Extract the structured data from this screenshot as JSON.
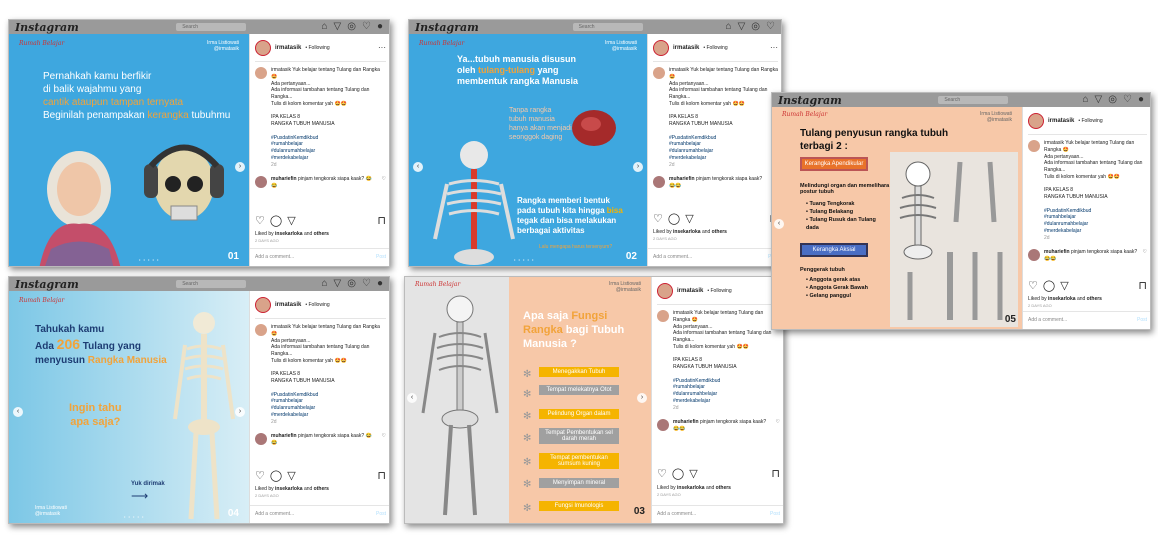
{
  "app": {
    "logo": "Instagram",
    "search": "Search"
  },
  "common": {
    "user": "irmatasik",
    "following": "• Following",
    "caption_lines": [
      "irmatasik Yuk belajar tentang Tulang dan Rangka 🤩",
      "Ada pertanyaan...",
      "Ada informasi tambahan tentang Tulang dan Rangka...",
      "Tulis di kolom komentar yah 🤩🤩"
    ],
    "class_lines": [
      "IPA KELAS 8",
      "RANGKA TUBUH MANUSIA"
    ],
    "hashtags": [
      "#PusdatinKemdikbud",
      "#rumahbelajar",
      "#dulanrumahbelajar",
      "#merdekabelajar"
    ],
    "days": "2d",
    "comment_user": "muhariefin",
    "comment_text": "pinjam tengkorak siapa kaak? 😂😂",
    "liked_pre": "Liked by",
    "liked_user": "insekarloka",
    "liked_and": "and",
    "liked_others": "others",
    "time": "2 DAYS AGO",
    "add_comment": "Add a comment...",
    "post_btn": "Post",
    "brand": "Rumah Belajar",
    "credit": "Irma Listiowati @irmatasik"
  },
  "slides": {
    "s1": {
      "l1": "Pernahkah kamu berfikir",
      "l2": "di balik wajahmu yang",
      "l3": "cantik ataupun tampan ternyata",
      "l4a": "Beginilah penampakan ",
      "l4b": "kerangka",
      "l4c": " tubuhmu",
      "num": "01"
    },
    "s2": {
      "l1a": "Ya...",
      "l1b": "tubuh manusia disusun",
      "l2a": "oleh ",
      "l2b": "tulang-tulang",
      "l2c": " yang",
      "l3": "membentuk rangka Manusia",
      "side": [
        "Tanpa rangka",
        "tubuh manusia",
        "hanya akan menjadi",
        "seonggok daging"
      ],
      "b1": "Rangka memberi bentuk",
      "b2a": "pada tubuh kita hingga ",
      "b2b": "bisa",
      "b3": "tegak dan bisa melakukan",
      "b4": "berbagai aktivitas",
      "foot": "Lalu mengapa harus tersenyum?",
      "num": "02"
    },
    "s3": {
      "l1": "Tahukah kamu",
      "l2a": "Ada ",
      "l2b": "206",
      "l2c": " Tulang yang",
      "l3a": "menyusun ",
      "l3b": "Rangka Manusia",
      "q1": "Ingin tahu",
      "q2": "apa saja?",
      "hint": "Yuk dirimak",
      "num": "04"
    },
    "s4": {
      "t1a": "Apa saja ",
      "t1b": "Fungsi",
      "t2a": "Rangka ",
      "t2b": "bagi Tubuh",
      "t3": "Manusia",
      "t4": "?",
      "items": [
        "Menegakkan Tubuh",
        "Tempat melekatnya Otot",
        "Pelindung Organ dalam",
        "Tempat Pembentukan sel darah merah",
        "Tempat pembentukan sumsum kuning",
        "Menyimpan mineral",
        "Fungsi Imunologis"
      ],
      "num": "03"
    },
    "s5": {
      "t1": "Tulang penyusun rangka tubuh",
      "t2": "terbagi 2 :",
      "box1": "Kerangka Apendikular",
      "d1": "Melindungi organ dan memelihara postur tubuh",
      "l1": [
        "Tuang Tengkorak",
        "Tulang Belakang",
        "Tulang Rusuk dan Tulang dada"
      ],
      "box2": "Kerangka Aksial",
      "d2": "Penggerak tubuh",
      "l2": [
        "Anggota gerak atas",
        "Anggota Gerak Bawah",
        "Gelang panggul"
      ],
      "num": "05"
    }
  },
  "colors": {
    "blue": "#3ea7df",
    "peach": "#f7c8a8",
    "orange": "#f2a33a",
    "orange2": "#f5b400",
    "darkblue": "#1d3c73"
  }
}
